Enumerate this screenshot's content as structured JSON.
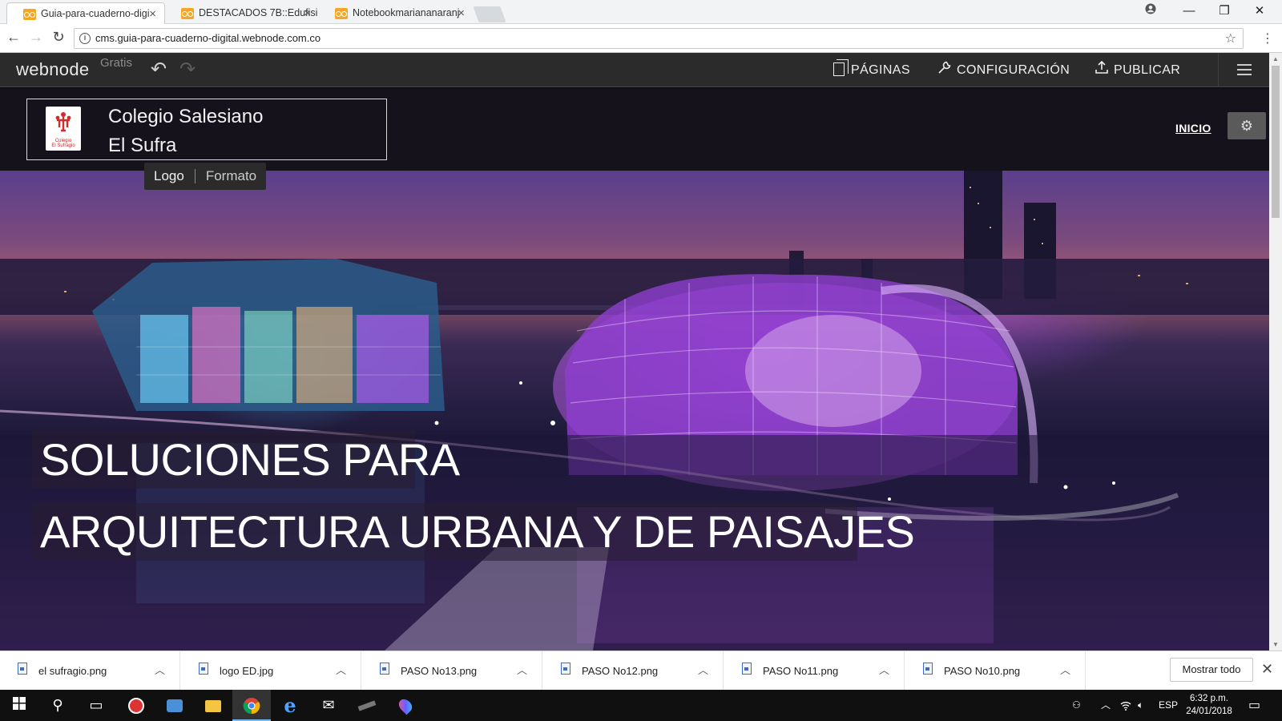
{
  "browser": {
    "tabs": [
      {
        "title": "Guia-para-cuaderno-digi",
        "active": true
      },
      {
        "title": "DESTACADOS 7B::Edufisi",
        "active": false
      },
      {
        "title": "Notebookmariananaranj",
        "active": false
      }
    ],
    "url": "cms.guia-para-cuaderno-digital.webnode.com.co"
  },
  "editor": {
    "brand": "webnode",
    "plan": "Gratis",
    "menu": {
      "pages": "PÁGINAS",
      "settings": "CONFIGURACIÓN",
      "publish": "PUBLICAR"
    }
  },
  "site": {
    "name_line1": "Colegio Salesiano",
    "name_line2": "El Sufra",
    "logo_caption": "Colegio El Sufragio",
    "logo_toolbar": {
      "logo": "Logo",
      "format": "Formato"
    },
    "nav_home": "INICIO"
  },
  "hero": {
    "line1": "SOLUCIONES PARA",
    "line2": "ARQUITECTURA URBANA Y DE PAISAJES"
  },
  "downloads": {
    "items": [
      "el sufragio.png",
      "logo ED.jpg",
      "PASO No13.png",
      "PASO No12.png",
      "PASO No11.png",
      "PASO No10.png"
    ],
    "show_all": "Mostrar todo"
  },
  "taskbar": {
    "language": "ESP",
    "time": "6:32 p.m.",
    "date": "24/01/2018"
  },
  "colors": {
    "editor_bar": "#2b2b2b",
    "site_header": "#15121c",
    "accent_purple": "#c84cff"
  }
}
